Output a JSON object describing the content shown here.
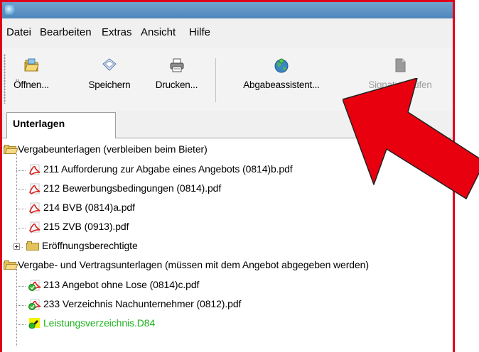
{
  "menu": {
    "items": [
      "Datei",
      "Bearbeiten",
      "Extras",
      "Ansicht",
      "Hilfe"
    ]
  },
  "toolbar": {
    "open_label": "Öffnen...",
    "save_label": "Speichern",
    "print_label": "Drucken...",
    "wizard_label": "Abgabeassistent...",
    "verify_label": "Signatur prüfen"
  },
  "tabs": {
    "active": "Unterlagen"
  },
  "tree": {
    "group1_label": "Vergabeunterlagen (verbleiben beim Bieter)",
    "group1_files": [
      "211 Aufforderung zur Abgabe eines Angebots (0814)b.pdf",
      "212 Bewerbungsbedingungen (0814).pdf",
      "214 BVB (0814)a.pdf",
      "215 ZVB (0913).pdf"
    ],
    "subfolder_label": "Eröffnungsberechtigte",
    "group2_label": "Vergabe- und Vertragsunterlagen (müssen mit dem Angebot abgegeben werden)",
    "group2_files": [
      "213 Angebot ohne Lose (0814)c.pdf",
      "233 Verzeichnis Nachunternehmer (0812).pdf"
    ],
    "special_file": "Leistungsverzeichnis.D84"
  },
  "colors": {
    "highlight_border": "#e0001b",
    "arrow": "#e8000f",
    "special_file_text": "#1db31d"
  }
}
